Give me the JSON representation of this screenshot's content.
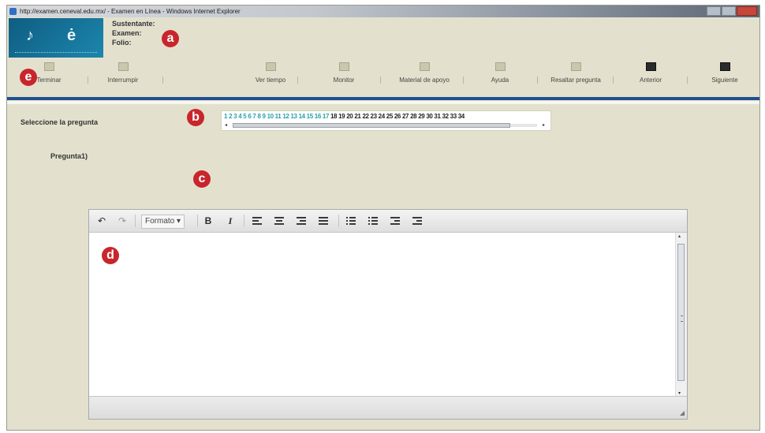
{
  "window": {
    "title": "http://examen.ceneval.edu.mx/ - Examen en Línea - Windows Internet Explorer"
  },
  "header": {
    "fields": [
      {
        "label": "Sustentante:"
      },
      {
        "label": "Examen:"
      },
      {
        "label": "Folio:"
      }
    ]
  },
  "toolbar": {
    "items": [
      {
        "label": "Terminar",
        "icon": "terminate-icon"
      },
      {
        "label": "Interrumpir",
        "icon": "pause-icon"
      },
      {
        "label": "Ver tiempo",
        "icon": "clock-icon"
      },
      {
        "label": "Monitor",
        "icon": "monitor-icon"
      },
      {
        "label": "Material de apoyo",
        "icon": "support-material-icon"
      },
      {
        "label": "Ayuda",
        "icon": "help-icon"
      },
      {
        "label": "Resaltar pregunta",
        "icon": "highlight-icon"
      },
      {
        "label": "Anterior",
        "icon": "previous-icon"
      },
      {
        "label": "Siguiente",
        "icon": "next-icon"
      }
    ]
  },
  "question_selector": {
    "label": "Seleccione la pregunta",
    "visited": [
      "1",
      "2",
      "3",
      "4",
      "5",
      "6",
      "7",
      "8",
      "9",
      "10",
      "11",
      "12",
      "13",
      "14",
      "15",
      "16",
      "17"
    ],
    "unvisited": [
      "18",
      "19",
      "20",
      "21",
      "22",
      "23",
      "24",
      "25",
      "26",
      "27",
      "28",
      "29",
      "30",
      "31",
      "32",
      "33",
      "34"
    ]
  },
  "question": {
    "label": "Pregunta1)"
  },
  "editor": {
    "format_label": "Formato ▾",
    "bold_label": "B",
    "italic_label": "I",
    "undo_icon": "↶",
    "redo_icon": "↷",
    "content": ""
  },
  "annotations": {
    "a": "a",
    "b": "b",
    "c": "c",
    "d": "d",
    "e": "e"
  },
  "colors": {
    "background": "#e3e1cd",
    "accent_blue": "#1f4f8f",
    "badge_red": "#c8262c",
    "visited_question": "#2aa0aa"
  }
}
